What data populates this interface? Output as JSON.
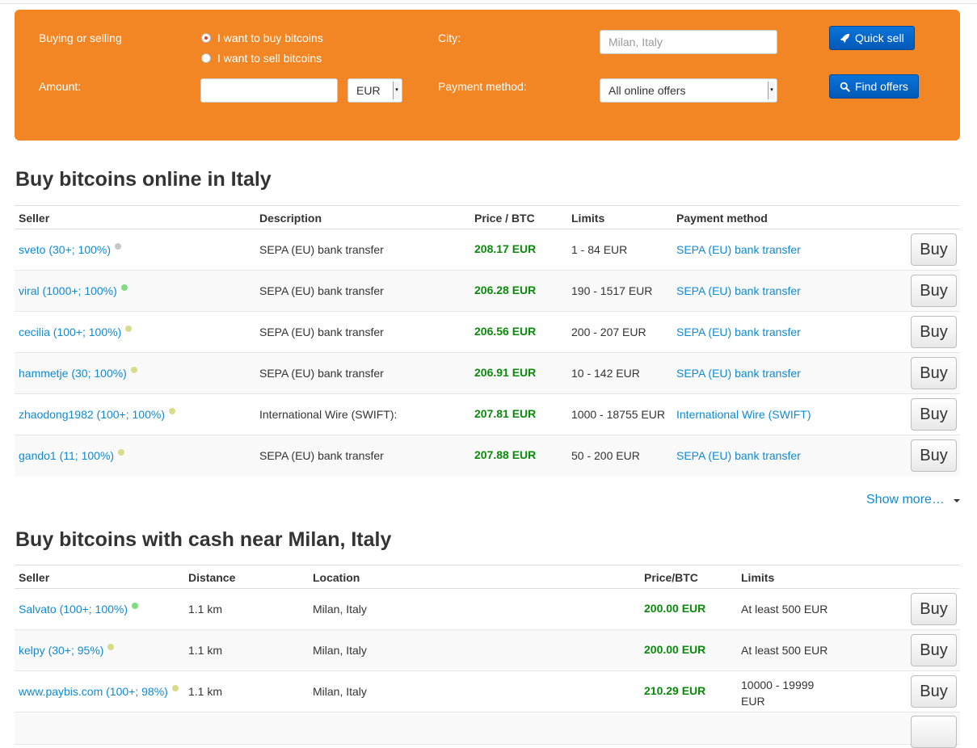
{
  "search": {
    "buying_selling_label": "Buying or selling",
    "buy_option": "I want to buy bitcoins",
    "sell_option": "I want to sell bitcoins",
    "amount_label": "Amount:",
    "amount_value": "",
    "currency": "EUR",
    "city_label": "City:",
    "city_placeholder": "Milan, Italy",
    "payment_label": "Payment method:",
    "payment_value": "All online offers",
    "quick_sell": "Quick sell",
    "find_offers": "Find offers"
  },
  "online": {
    "title": "Buy bitcoins online in Italy",
    "headers": [
      "Seller",
      "Description",
      "Price / BTC",
      "Limits",
      "Payment method"
    ],
    "rows": [
      {
        "seller": "sveto (30+; 100%)",
        "status": "grey",
        "desc": "SEPA (EU) bank transfer",
        "price": "208.17 EUR",
        "limits": "1 - 84 EUR",
        "method": "SEPA (EU) bank transfer",
        "action": "Buy"
      },
      {
        "seller": "viral (1000+; 100%)",
        "status": "green",
        "desc": "SEPA (EU) bank transfer",
        "price": "206.28 EUR",
        "limits": "190 - 1517 EUR",
        "method": "SEPA (EU) bank transfer",
        "action": "Buy"
      },
      {
        "seller": "cecilia (100+; 100%)",
        "status": "yellow",
        "desc": "SEPA (EU) bank transfer",
        "price": "206.56 EUR",
        "limits": "200 - 207 EUR",
        "method": "SEPA (EU) bank transfer",
        "action": "Buy"
      },
      {
        "seller": "hammetje (30; 100%)",
        "status": "yellow",
        "desc": "SEPA (EU) bank transfer",
        "price": "206.91 EUR",
        "limits": "10 - 142 EUR",
        "method": "SEPA (EU) bank transfer",
        "action": "Buy"
      },
      {
        "seller": "zhaodong1982 (100+; 100%)",
        "status": "yellow",
        "desc": "International Wire (SWIFT):",
        "price": "207.81 EUR",
        "limits": "1000 - 18755 EUR",
        "method": "International Wire (SWIFT)",
        "action": "Buy"
      },
      {
        "seller": "gando1 (11; 100%)",
        "status": "yellow",
        "desc": "SEPA (EU) bank transfer",
        "price": "207.88 EUR",
        "limits": "50 - 200 EUR",
        "method": "SEPA (EU) bank transfer",
        "action": "Buy"
      }
    ],
    "show_more": "Show more…"
  },
  "cash": {
    "title": "Buy bitcoins with cash near Milan, Italy",
    "headers": [
      "Seller",
      "Distance",
      "Location",
      "Price/BTC",
      "Limits"
    ],
    "rows": [
      {
        "seller": "Salvato (100+; 100%)",
        "status": "green",
        "distance": "1.1 km",
        "location": "Milan, Italy",
        "price": "200.00 EUR",
        "limits": "At least 500 EUR",
        "action": "Buy"
      },
      {
        "seller": "kelpy (30+; 95%)",
        "status": "yellow",
        "distance": "1.1 km",
        "location": "Milan, Italy",
        "price": "200.00 EUR",
        "limits": "At least 500 EUR",
        "action": "Buy"
      },
      {
        "seller": "www.paybis.com (100+; 98%)",
        "status": "yellow",
        "distance": "1.1 km",
        "location": "Milan, Italy",
        "price": "210.29 EUR",
        "limits_line1": "10000 - 19999",
        "limits_line2": "EUR",
        "action": "Buy"
      }
    ]
  },
  "colors": {
    "panel": "#f28624",
    "link": "#0f8ad4",
    "price": "#0a8a0a",
    "button_blue": "#0259b8"
  }
}
